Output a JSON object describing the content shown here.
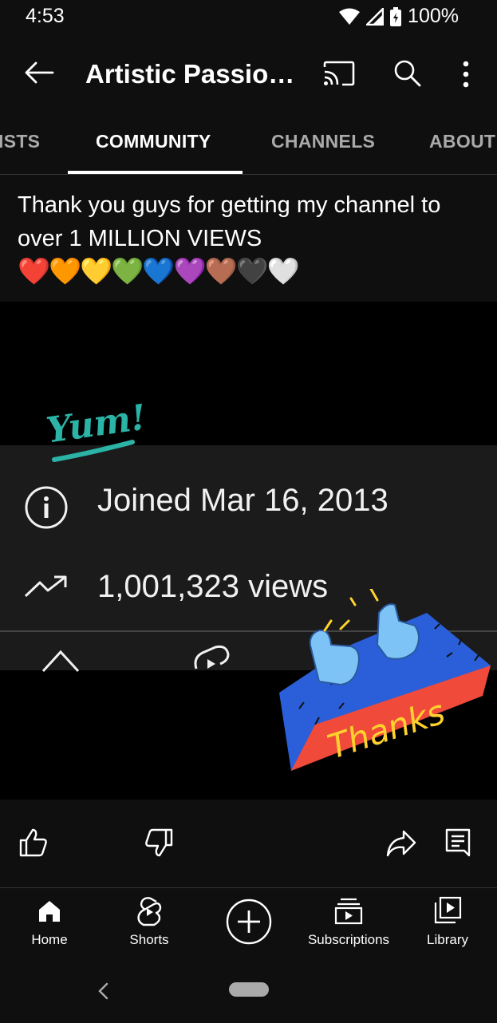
{
  "status": {
    "time": "4:53",
    "battery": "100%"
  },
  "appbar": {
    "title": "Artistic Passio…"
  },
  "tabs": [
    {
      "label": "ISTS"
    },
    {
      "label": "COMMUNITY"
    },
    {
      "label": "CHANNELS"
    },
    {
      "label": "ABOUT"
    }
  ],
  "post": {
    "text": "Thank you guys for getting my channel to over 1 MILLION VIEWS",
    "hearts": "❤️🧡💛💚💙💜🤎🖤🤍",
    "media": {
      "sticker_yum": "Yum!",
      "joined": "Joined Mar 16, 2013",
      "views": "1,001,323 views",
      "sticker_thanks": "Thanks"
    }
  },
  "nav": [
    {
      "label": "Home"
    },
    {
      "label": "Shorts"
    },
    {
      "label": ""
    },
    {
      "label": "Subscriptions"
    },
    {
      "label": "Library"
    }
  ],
  "colors": {
    "background": "#0f0f0f",
    "accent_teal": "#2bb3a6",
    "sticker_blue": "#2b5fd9",
    "sticker_red": "#f04a3b",
    "sticker_yellow": "#ffd22e"
  }
}
